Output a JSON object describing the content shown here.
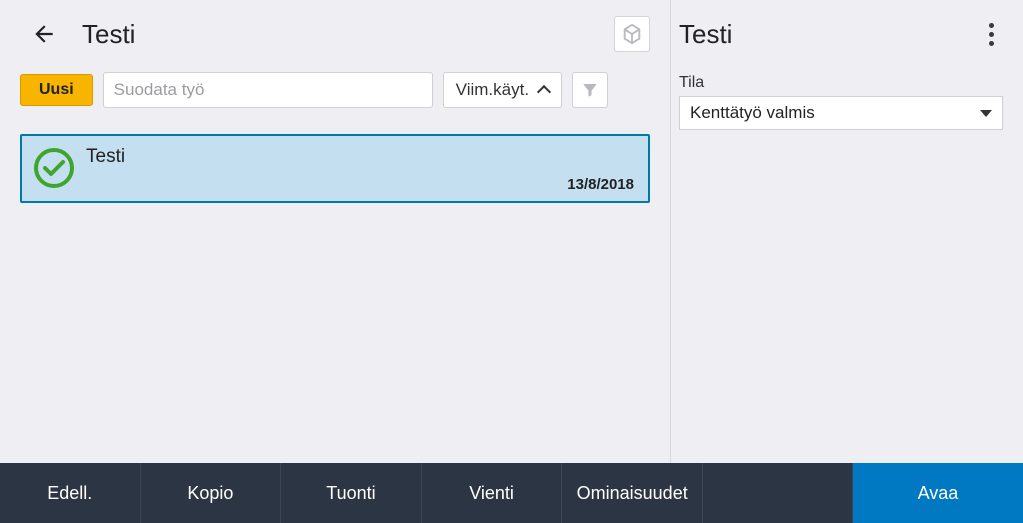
{
  "header": {
    "title": "Testi"
  },
  "toolbar": {
    "new_label": "Uusi",
    "filter_placeholder": "Suodata työ",
    "sort_label": "Viim.käyt."
  },
  "jobs": [
    {
      "title": "Testi",
      "date": "13/8/2018"
    }
  ],
  "detail": {
    "title": "Testi",
    "status_label": "Tila",
    "status_value": "Kenttätyö valmis"
  },
  "footer": {
    "prev": "Edell.",
    "copy": "Kopio",
    "import": "Tuonti",
    "export": "Vienti",
    "properties": "Ominaisuudet",
    "open": "Avaa"
  }
}
